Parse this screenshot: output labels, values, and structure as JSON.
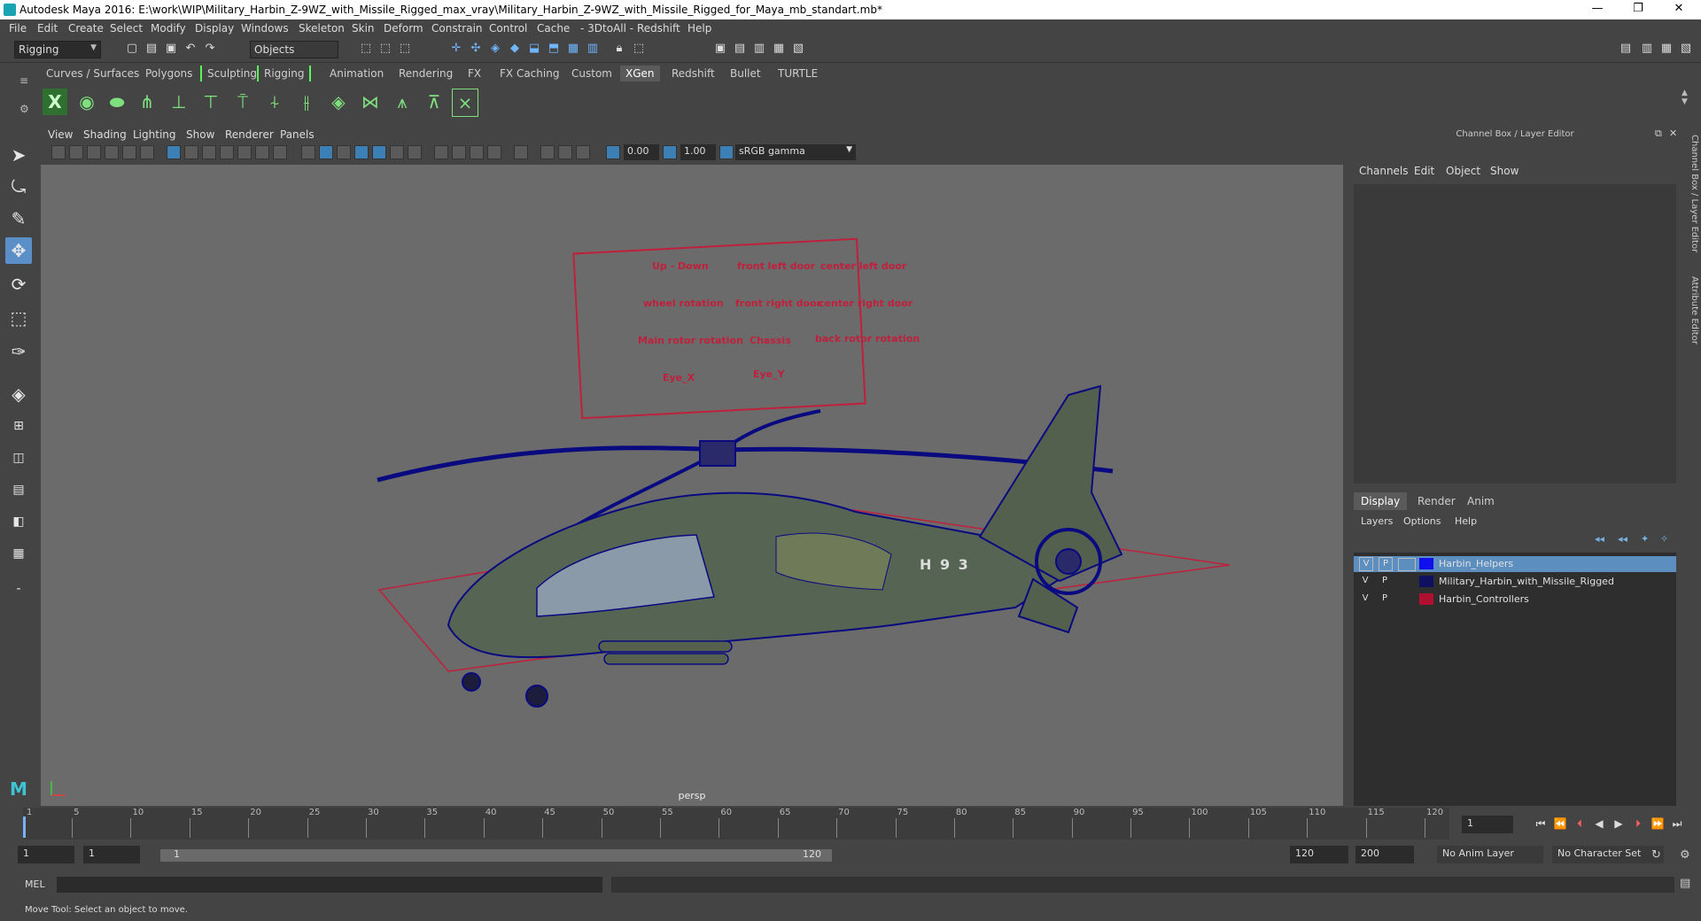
{
  "window": {
    "title": "Autodesk Maya 2016: E:\\work\\WIP\\Military_Harbin_Z-9WZ_with_Missile_Rigged_max_vray\\Military_Harbin_Z-9WZ_with_Missile_Rigged_for_Maya_mb_standart.mb*",
    "minimize": "—",
    "restore": "❐",
    "close": "✕"
  },
  "menus": [
    "File",
    "Edit",
    "Create",
    "Select",
    "Modify",
    "Display",
    "Windows",
    "Skeleton",
    "Skin",
    "Deform",
    "Constrain",
    "Control",
    "Cache",
    "- 3DtoAll -",
    "Redshift",
    "Help"
  ],
  "statusline": {
    "menuset": "Rigging",
    "selection_mode": "Objects"
  },
  "shelf": {
    "tabs": [
      "Curves / Surfaces",
      "Polygons",
      "Sculpting",
      "Rigging",
      "Animation",
      "Rendering",
      "FX",
      "FX Caching",
      "Custom",
      "XGen",
      "Redshift",
      "Bullet",
      "TURTLE"
    ],
    "active_tab": "XGen"
  },
  "viewport": {
    "menus": [
      "View",
      "Shading",
      "Lighting",
      "Show",
      "Renderer",
      "Panels"
    ],
    "exposure": "0.00",
    "gamma": "1.00",
    "color_space": "sRGB gamma",
    "camera_label": "persp",
    "controls_panel": {
      "labels": [
        "Up - Down",
        "front left door",
        "center left door",
        "wheel rotation",
        "front right door",
        "center right door",
        "Main rotor rotation",
        "Chassis",
        "back rotor rotation",
        "Eye_X",
        "Eye_Y"
      ]
    },
    "tail_code": "H 9 3"
  },
  "channel_box": {
    "title": "Channel Box / Layer Editor",
    "menus": [
      "Channels",
      "Edit",
      "Object",
      "Show"
    ],
    "layer_tabs": [
      "Display",
      "Render",
      "Anim"
    ],
    "active_layer_tab": "Display",
    "layer_menus": [
      "Layers",
      "Options",
      "Help"
    ],
    "layers": [
      {
        "v": "V",
        "p": "P",
        "name": "Harbin_Helpers",
        "color": "#1010ee",
        "selected": true
      },
      {
        "v": "V",
        "p": "P",
        "name": "Military_Harbin_with_Missile_Rigged",
        "color": "#101060",
        "selected": false
      },
      {
        "v": "V",
        "p": "P",
        "name": "Harbin_Controllers",
        "color": "#b01030",
        "selected": false
      }
    ],
    "side_tabs": [
      "Channel Box / Layer Editor",
      "Attribute Editor"
    ]
  },
  "timeline": {
    "ticks": [
      "1",
      "5",
      "10",
      "15",
      "20",
      "25",
      "30",
      "35",
      "40",
      "45",
      "50",
      "55",
      "60",
      "65",
      "70",
      "75",
      "80",
      "85",
      "90",
      "95",
      "100",
      "105",
      "110",
      "115",
      "120"
    ],
    "current_frame": "1",
    "range_start": "1",
    "range_start_inner": "1",
    "slider_start": "1",
    "slider_end": "120",
    "range_end_inner": "120",
    "range_end": "200",
    "anim_layer": "No Anim Layer",
    "character_set": "No Character Set"
  },
  "command_line": {
    "label": "MEL"
  },
  "help_line": "Move Tool: Select an object to move."
}
